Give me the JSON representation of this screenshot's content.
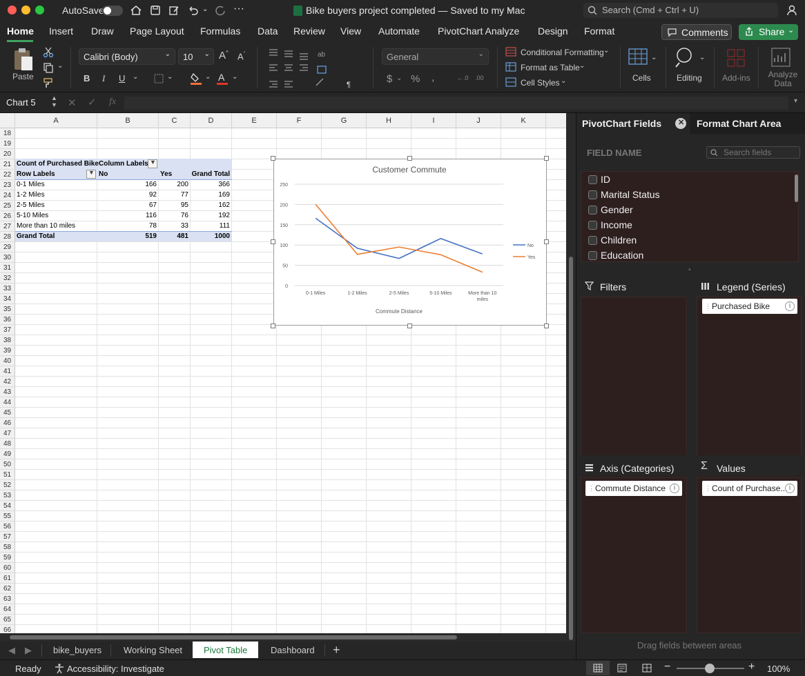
{
  "titlebar": {
    "autosave_label": "AutoSave",
    "doc_title": "Bike buyers project completed — Saved to my Mac",
    "search_placeholder": "Search (Cmd + Ctrl + U)"
  },
  "ribbon_tabs": [
    "Home",
    "Insert",
    "Draw",
    "Page Layout",
    "Formulas",
    "Data",
    "Review",
    "View",
    "Automate",
    "PivotChart Analyze",
    "Design",
    "Format"
  ],
  "ribbon_actions": {
    "comments_label": "Comments",
    "share_label": "Share"
  },
  "ribbon": {
    "paste_label": "Paste",
    "font_name": "Calibri (Body)",
    "font_size": "10",
    "number_format": "General",
    "conditional_formatting": "Conditional Formatting",
    "format_as_table": "Format as Table",
    "cell_styles": "Cell Styles",
    "cells_label": "Cells",
    "editing_label": "Editing",
    "addins_label": "Add-ins",
    "analyze_data_label": "Analyze Data",
    "accent_fill": "#f0703a",
    "accent_font": "#e2342a"
  },
  "formula_bar": {
    "name_box": "Chart 5",
    "fx": "fx",
    "content": ""
  },
  "columns": [
    "A",
    "B",
    "C",
    "D",
    "E",
    "F",
    "G",
    "H",
    "I",
    "J",
    "K"
  ],
  "rows": [
    "18",
    "19",
    "20",
    "21",
    "22",
    "23",
    "24",
    "25",
    "26",
    "27",
    "28",
    "29",
    "30",
    "31",
    "32",
    "33",
    "34",
    "35",
    "36",
    "37",
    "38",
    "39",
    "40",
    "41",
    "42",
    "43",
    "44",
    "45",
    "46",
    "47",
    "48",
    "49",
    "50",
    "51",
    "52",
    "53",
    "54",
    "55",
    "56",
    "57",
    "58",
    "59",
    "60",
    "61",
    "62",
    "63",
    "64",
    "65",
    "66"
  ],
  "pivot": {
    "header1": [
      "Count of Purchased Bike",
      "Column Labels",
      "",
      ""
    ],
    "header2": [
      "Row Labels",
      "No",
      "Yes",
      "Grand Total"
    ],
    "rows": [
      [
        "0-1 Miles",
        "166",
        "200",
        "366"
      ],
      [
        "1-2 Miles",
        "92",
        "77",
        "169"
      ],
      [
        "2-5 Miles",
        "67",
        "95",
        "162"
      ],
      [
        "5-10 Miles",
        "116",
        "76",
        "192"
      ],
      [
        "More than 10 miles",
        "78",
        "33",
        "111"
      ]
    ],
    "total": [
      "Grand Total",
      "519",
      "481",
      "1000"
    ]
  },
  "chart_data": {
    "type": "line",
    "title": "Customer Commute",
    "xlabel": "Commute Distance",
    "ylabel": "",
    "categories": [
      "0-1 Miles",
      "1-2 Miles",
      "2-5 Miles",
      "5-10 Miles",
      "More than 10 miles"
    ],
    "series": [
      {
        "name": "No",
        "values": [
          166,
          92,
          67,
          116,
          78
        ],
        "color": "#4472c4"
      },
      {
        "name": "Yes",
        "values": [
          200,
          77,
          95,
          76,
          33
        ],
        "color": "#ed7d31"
      }
    ],
    "ylim": [
      0,
      250
    ],
    "yticks": [
      "0",
      "50",
      "100",
      "150",
      "200",
      "250"
    ],
    "grid": true,
    "legend_position": "right"
  },
  "sheet_tabs": [
    "bike_buyers",
    "Working Sheet",
    "Pivot Table",
    "Dashboard"
  ],
  "active_sheet": "Pivot Table",
  "status": {
    "ready": "Ready",
    "accessibility": "Accessibility: Investigate",
    "zoom": "100%"
  },
  "pane": {
    "tab1": "PivotChart Fields",
    "tab2": "Format Chart Area",
    "field_name_label": "FIELD NAME",
    "search_placeholder": "Search fields",
    "fields": [
      "ID",
      "Marital Status",
      "Gender",
      "Income",
      "Children",
      "Education"
    ],
    "filters_label": "Filters",
    "legend_label": "Legend (Series)",
    "axis_label": "Axis (Categories)",
    "values_label": "Values",
    "legend_item": "Purchased Bike",
    "axis_item": "Commute Distance",
    "values_item": "Count of Purchase...",
    "footer": "Drag fields between areas"
  }
}
